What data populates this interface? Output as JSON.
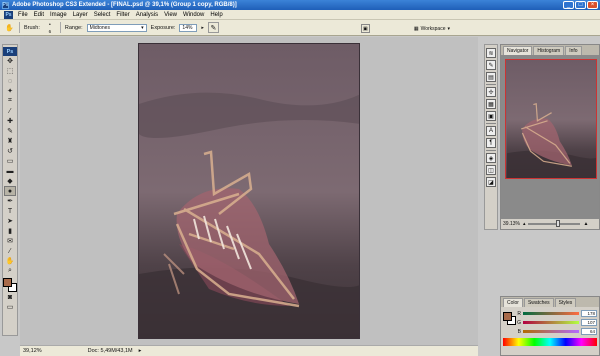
{
  "window": {
    "title": "Adobe Photoshop CS3 Extended - [FINAL.psd @ 39,1% (Group 1 copy, RGB/8)]",
    "app_icon": "Ps",
    "minimize_icon": "minimize-icon",
    "maximize_icon": "maximize-icon",
    "close_icon": "close-icon"
  },
  "menubar": {
    "items": [
      "File",
      "Edit",
      "Image",
      "Layer",
      "Select",
      "Filter",
      "Analysis",
      "View",
      "Window",
      "Help"
    ]
  },
  "options": {
    "brush_label": "Brush:",
    "brush_size": "6",
    "range_label": "Range:",
    "range_value": "Midtones",
    "exposure_label": "Exposure:",
    "exposure_value": "14%",
    "workspace_label": "Workspace"
  },
  "toolbox": {
    "logo": "Ps",
    "foreground_color": "#a86a4a",
    "background_color": "#ffffff"
  },
  "statusbar": {
    "zoom": "39,12%",
    "doc_info": "Doc: 5,49M/43,1M"
  },
  "navigator": {
    "tabs": [
      "Navigator",
      "Histogram",
      "Info"
    ],
    "zoom": "39.13%"
  },
  "color": {
    "tabs": [
      "Color",
      "Swatches",
      "Styles"
    ],
    "channels": [
      {
        "label": "R",
        "value": "178"
      },
      {
        "label": "G",
        "value": "107"
      },
      {
        "label": "B",
        "value": "64"
      }
    ]
  },
  "colors": {
    "accent": "#2f74d0",
    "navigator_frame": "#cc3333"
  }
}
